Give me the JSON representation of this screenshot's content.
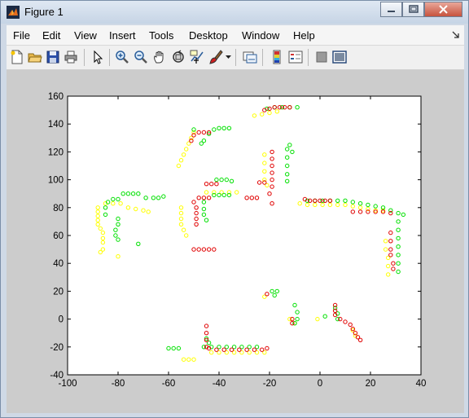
{
  "window": {
    "title": "Figure 1"
  },
  "menu": [
    "File",
    "Edit",
    "View",
    "Insert",
    "Tools",
    "Desktop",
    "Window",
    "Help"
  ],
  "toolbar_icons": [
    "new-figure-icon",
    "open-file-icon",
    "save-icon",
    "print-icon",
    "pointer-icon",
    "zoom-in-icon",
    "zoom-out-icon",
    "pan-hand-icon",
    "rotate-3d-icon",
    "data-cursor-icon",
    "brush-icon",
    "brush-dropdown-icon",
    "link-plot-icon",
    "colorbar-icon",
    "legend-icon",
    "hide-plot-tools-icon",
    "show-plot-tools-icon"
  ],
  "colors": {
    "yellow": "#ffff00",
    "green": "#00e000",
    "red": "#e00000"
  },
  "chart_data": {
    "type": "scatter",
    "xlim": [
      -100,
      40
    ],
    "ylim": [
      -40,
      160
    ],
    "xticks": [
      -100,
      -80,
      -60,
      -40,
      -20,
      0,
      20,
      40
    ],
    "yticks": [
      -40,
      -20,
      0,
      20,
      40,
      60,
      80,
      100,
      120,
      140,
      160
    ],
    "grid": false,
    "marker": "open-circle",
    "series": [
      {
        "color": "yellow",
        "points": [
          [
            -88,
            80
          ],
          [
            -88,
            77
          ],
          [
            -88,
            74
          ],
          [
            -88,
            71
          ],
          [
            -88,
            68
          ],
          [
            -87,
            65
          ],
          [
            -86,
            62
          ],
          [
            -86,
            58
          ],
          [
            -86,
            55
          ],
          [
            -86,
            50
          ],
          [
            -87,
            48
          ],
          [
            -85,
            83
          ],
          [
            -82,
            83
          ],
          [
            -79,
            83
          ],
          [
            -76,
            80
          ],
          [
            -73,
            79
          ],
          [
            -70,
            78
          ],
          [
            -68,
            77
          ],
          [
            -55,
            80
          ],
          [
            -55,
            76
          ],
          [
            -55,
            72
          ],
          [
            -55,
            68
          ],
          [
            -54,
            64
          ],
          [
            -53,
            60
          ],
          [
            -56,
            110
          ],
          [
            -55,
            114
          ],
          [
            -54,
            118
          ],
          [
            -53,
            122
          ],
          [
            -52,
            126
          ],
          [
            -51,
            130
          ],
          [
            -50,
            134
          ],
          [
            -45,
            91
          ],
          [
            -42,
            91
          ],
          [
            -39,
            91
          ],
          [
            -36,
            91
          ],
          [
            -33,
            91
          ],
          [
            -43,
            -24
          ],
          [
            -40,
            -24
          ],
          [
            -37,
            -24
          ],
          [
            -34,
            -24
          ],
          [
            -31,
            -24
          ],
          [
            -28,
            -24
          ],
          [
            -25,
            -24
          ],
          [
            -22,
            -24
          ],
          [
            -54,
            -29
          ],
          [
            -52,
            -29
          ],
          [
            -50,
            -29
          ],
          [
            -22,
            118
          ],
          [
            -22,
            112
          ],
          [
            -22,
            106
          ],
          [
            -22,
            100
          ],
          [
            -21,
            96
          ],
          [
            -26,
            146
          ],
          [
            -23,
            147
          ],
          [
            -20,
            148
          ],
          [
            -17,
            149
          ],
          [
            -8,
            83
          ],
          [
            -5,
            82
          ],
          [
            -2,
            82
          ],
          [
            1,
            82
          ],
          [
            4,
            82
          ],
          [
            7,
            82
          ],
          [
            10,
            82
          ],
          [
            13,
            81
          ],
          [
            16,
            80
          ],
          [
            19,
            79
          ],
          [
            22,
            78
          ],
          [
            25,
            78
          ],
          [
            -22,
            16
          ],
          [
            -12,
            0
          ],
          [
            -10,
            -3
          ],
          [
            -1,
            0
          ],
          [
            -80,
            45
          ],
          [
            26,
            56
          ],
          [
            26,
            50
          ],
          [
            27,
            44
          ],
          [
            27,
            38
          ],
          [
            27,
            32
          ],
          [
            13,
            -8
          ],
          [
            14,
            -12
          ]
        ]
      },
      {
        "color": "green",
        "points": [
          [
            -85,
            75
          ],
          [
            -85,
            80
          ],
          [
            -84,
            84
          ],
          [
            -82,
            86
          ],
          [
            -80,
            86
          ],
          [
            -78,
            90
          ],
          [
            -76,
            90
          ],
          [
            -74,
            90
          ],
          [
            -72,
            90
          ],
          [
            -69,
            87
          ],
          [
            -66,
            87
          ],
          [
            -64,
            87
          ],
          [
            -62,
            88
          ],
          [
            -80,
            72
          ],
          [
            -80,
            68
          ],
          [
            -81,
            64
          ],
          [
            -81,
            60
          ],
          [
            -80,
            57
          ],
          [
            -72,
            54
          ],
          [
            -46,
            84
          ],
          [
            -46,
            79
          ],
          [
            -46,
            75
          ],
          [
            -45,
            71
          ],
          [
            -50,
            136
          ],
          [
            -47,
            126
          ],
          [
            -46,
            128
          ],
          [
            -44,
            133
          ],
          [
            -42,
            136
          ],
          [
            -40,
            137
          ],
          [
            -38,
            137
          ],
          [
            -36,
            137
          ],
          [
            -42,
            89
          ],
          [
            -40,
            89
          ],
          [
            -38,
            89
          ],
          [
            -36,
            89
          ],
          [
            -41,
            100
          ],
          [
            -39,
            100
          ],
          [
            -37,
            100
          ],
          [
            -35,
            99
          ],
          [
            -9,
            152
          ],
          [
            -12,
            152
          ],
          [
            -15,
            152
          ],
          [
            -18,
            152
          ],
          [
            -21,
            151
          ],
          [
            -13,
            122
          ],
          [
            -13,
            116
          ],
          [
            -13,
            110
          ],
          [
            -13,
            104
          ],
          [
            -13,
            99
          ],
          [
            -12,
            125
          ],
          [
            -11,
            120
          ],
          [
            -5,
            85
          ],
          [
            -2,
            85
          ],
          [
            1,
            85
          ],
          [
            4,
            85
          ],
          [
            7,
            85
          ],
          [
            10,
            85
          ],
          [
            13,
            84
          ],
          [
            16,
            83
          ],
          [
            19,
            82
          ],
          [
            22,
            81
          ],
          [
            25,
            80
          ],
          [
            28,
            78
          ],
          [
            31,
            76
          ],
          [
            33,
            75
          ],
          [
            31,
            70
          ],
          [
            31,
            64
          ],
          [
            31,
            58
          ],
          [
            31,
            52
          ],
          [
            31,
            46
          ],
          [
            31,
            40
          ],
          [
            31,
            34
          ],
          [
            -19,
            20
          ],
          [
            -17,
            20
          ],
          [
            -18,
            17
          ],
          [
            -10,
            10
          ],
          [
            -9,
            5
          ],
          [
            -9,
            0
          ],
          [
            -10,
            -3
          ],
          [
            -60,
            -21
          ],
          [
            -58,
            -21
          ],
          [
            -56,
            -21
          ],
          [
            -46,
            -20
          ],
          [
            -43,
            -20
          ],
          [
            -40,
            -20
          ],
          [
            -37,
            -20
          ],
          [
            -34,
            -20
          ],
          [
            -31,
            -20
          ],
          [
            -28,
            -20
          ],
          [
            -25,
            -20
          ],
          [
            -45,
            -14
          ],
          [
            -44,
            -17
          ],
          [
            2,
            2
          ],
          [
            6,
            8
          ],
          [
            7,
            4
          ],
          [
            7,
            0
          ]
        ]
      },
      {
        "color": "red",
        "points": [
          [
            -51,
            128
          ],
          [
            -50,
            132
          ],
          [
            -48,
            134
          ],
          [
            -46,
            134
          ],
          [
            -44,
            134
          ],
          [
            -50,
            84
          ],
          [
            -49,
            80
          ],
          [
            -49,
            76
          ],
          [
            -49,
            72
          ],
          [
            -49,
            68
          ],
          [
            -48,
            87
          ],
          [
            -46,
            87
          ],
          [
            -44,
            87
          ],
          [
            -45,
            97
          ],
          [
            -43,
            97
          ],
          [
            -41,
            97
          ],
          [
            -50,
            50
          ],
          [
            -48,
            50
          ],
          [
            -46,
            50
          ],
          [
            -44,
            50
          ],
          [
            -42,
            50
          ],
          [
            -22,
            150
          ],
          [
            -20,
            151
          ],
          [
            -18,
            152
          ],
          [
            -16,
            152
          ],
          [
            -14,
            152
          ],
          [
            -12,
            152
          ],
          [
            -19,
            120
          ],
          [
            -19,
            115
          ],
          [
            -19,
            110
          ],
          [
            -19,
            105
          ],
          [
            -19,
            100
          ],
          [
            -19,
            95
          ],
          [
            -20,
            90
          ],
          [
            -25,
            87
          ],
          [
            -27,
            87
          ],
          [
            -29,
            87
          ],
          [
            -19,
            83
          ],
          [
            -22,
            98
          ],
          [
            -24,
            98
          ],
          [
            -6,
            86
          ],
          [
            -4,
            85
          ],
          [
            -2,
            85
          ],
          [
            0,
            85
          ],
          [
            2,
            85
          ],
          [
            4,
            85
          ],
          [
            13,
            77
          ],
          [
            16,
            77
          ],
          [
            19,
            77
          ],
          [
            22,
            77
          ],
          [
            25,
            77
          ],
          [
            28,
            76
          ],
          [
            28,
            62
          ],
          [
            28,
            56
          ],
          [
            28,
            50
          ],
          [
            28,
            46
          ],
          [
            29,
            40
          ],
          [
            29,
            36
          ],
          [
            -45,
            -5
          ],
          [
            -45,
            -10
          ],
          [
            -45,
            -15
          ],
          [
            -45,
            -20
          ],
          [
            -44,
            -21
          ],
          [
            -41,
            -22
          ],
          [
            -38,
            -22
          ],
          [
            -35,
            -22
          ],
          [
            -32,
            -22
          ],
          [
            -29,
            -22
          ],
          [
            -26,
            -22
          ],
          [
            -23,
            -22
          ],
          [
            -21,
            -21
          ],
          [
            6,
            10
          ],
          [
            6,
            6
          ],
          [
            6,
            3
          ],
          [
            8,
            0
          ],
          [
            10,
            -2
          ],
          [
            12,
            -4
          ],
          [
            13,
            -7
          ],
          [
            14,
            -10
          ],
          [
            15,
            -13
          ],
          [
            16,
            -15
          ],
          [
            -11,
            0
          ],
          [
            -11,
            -3
          ],
          [
            -21,
            18
          ]
        ]
      }
    ]
  }
}
